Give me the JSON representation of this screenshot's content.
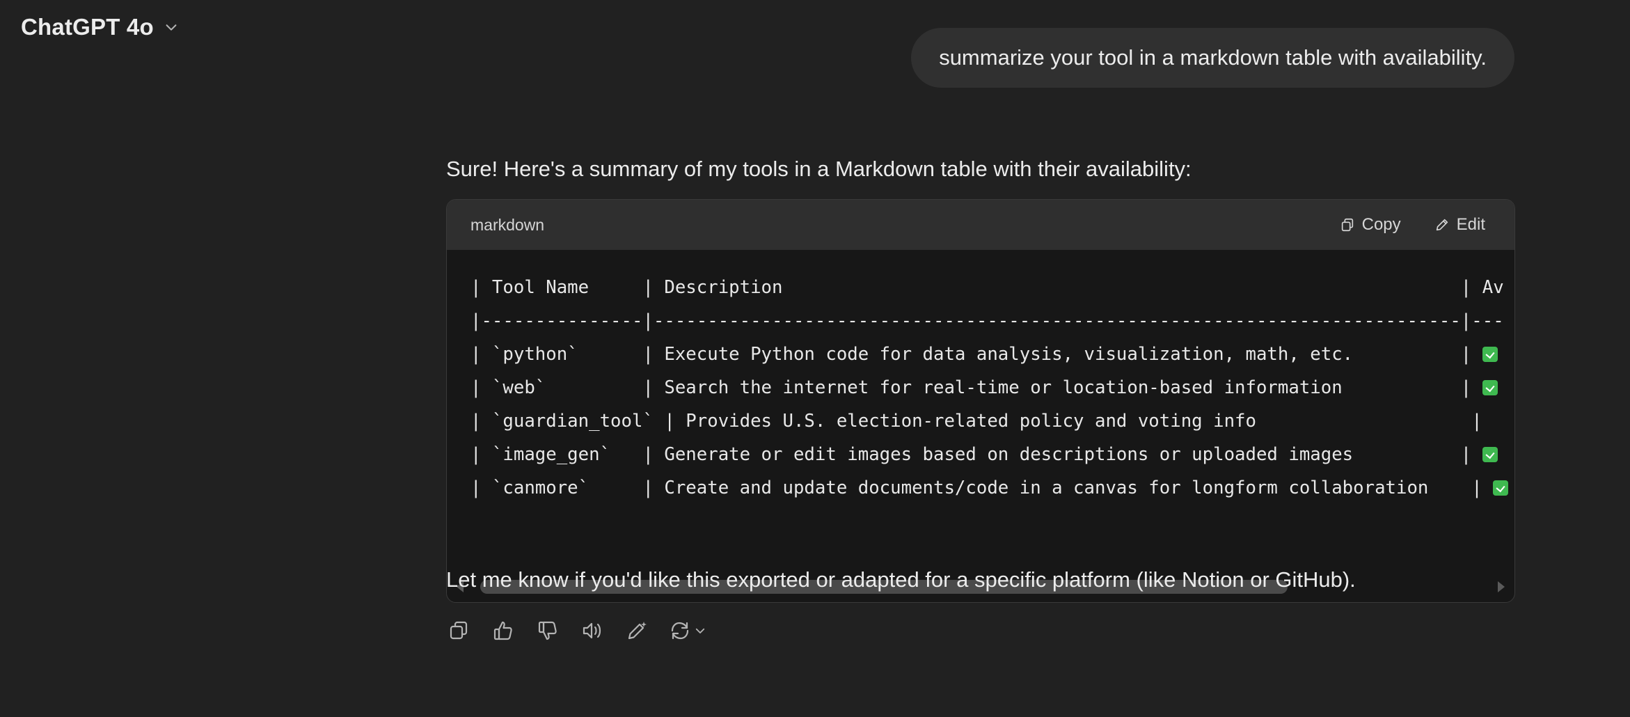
{
  "header": {
    "model_name": "ChatGPT 4o",
    "model_chevron_icon": "chevron-down-icon"
  },
  "user_message": {
    "text": "summarize your tool in a markdown table with availability."
  },
  "assistant": {
    "intro": "Sure! Here's a summary of my tools in a Markdown table with their availability:",
    "code_block": {
      "language": "markdown",
      "copy_label": "Copy",
      "edit_label": "Edit",
      "lines": [
        "| Tool Name     | Description                                                               | Av",
        "|---------------|---------------------------------------------------------------------------|---",
        "| `python`      | Execute Python code for data analysis, visualization, math, etc.          | ",
        "| `web`         | Search the internet for real-time or location-based information           | ",
        "| `guardian_tool` | Provides U.S. election-related policy and voting info                    | ",
        "| `image_gen`   | Generate or edit images based on descriptions or uploaded images          | ",
        "| `canmore`     | Create and update documents/code in a canvas for longform collaboration    | "
      ],
      "check_rows": [
        2,
        3,
        5,
        6
      ]
    },
    "outro": "Let me know if you'd like this exported or adapted for a specific platform (like Notion or GitHub).",
    "action_icons": [
      "copy-icon",
      "thumbs-up-icon",
      "thumbs-down-icon",
      "read-aloud-icon",
      "edit-canvas-icon",
      "regenerate-icon"
    ]
  },
  "colors": {
    "background": "#212121",
    "user_bubble": "#303030",
    "code_header": "#2f2f2f",
    "code_body": "#171717",
    "check_green": "#3fb950"
  }
}
